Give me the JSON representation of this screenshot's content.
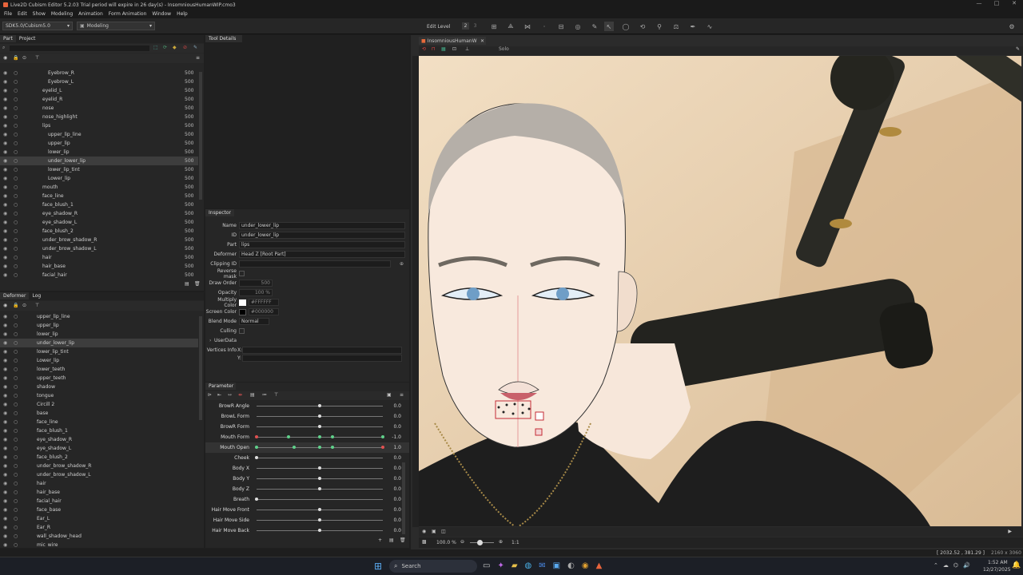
{
  "window": {
    "title": "Live2D Cubism Editor 5.2.03   Trial period will expire in 26 day(s)   - InsomniousHumanWIP.cmo3"
  },
  "menu": [
    "File",
    "Edit",
    "Show",
    "Modeling",
    "Animation",
    "Form Animation",
    "Window",
    "Help"
  ],
  "toolbar": {
    "sdk": "SDK5.0/Cubism5.0",
    "mode": "Modeling",
    "edit_level_label": "Edit Level",
    "edit_level_1": "2",
    "edit_level_2": "3"
  },
  "left_tabs": {
    "part": "Part",
    "project": "Project"
  },
  "parts": [
    {
      "name": "Eyebrow_R",
      "val": "500"
    },
    {
      "name": "Eyebrow_L",
      "val": "500"
    },
    {
      "name": "eyelid_L",
      "val": "500"
    },
    {
      "name": "eyelid_R",
      "val": "500"
    },
    {
      "name": "nose",
      "val": "500"
    },
    {
      "name": "nose_highlight",
      "val": "500"
    },
    {
      "name": "lips",
      "val": "500"
    },
    {
      "name": "upper_lip_line",
      "val": "500"
    },
    {
      "name": "upper_lip",
      "val": "500"
    },
    {
      "name": "lower_lip",
      "val": "500"
    },
    {
      "name": "under_lower_lip",
      "val": "500"
    },
    {
      "name": "lower_lip_tint",
      "val": "500"
    },
    {
      "name": "Lower_lip",
      "val": "500"
    },
    {
      "name": "mouth",
      "val": "500"
    },
    {
      "name": "face_line",
      "val": "500"
    },
    {
      "name": "face_blush_1",
      "val": "500"
    },
    {
      "name": "eye_shadow_R",
      "val": "500"
    },
    {
      "name": "eye_shadow_L",
      "val": "500"
    },
    {
      "name": "face_blush_2",
      "val": "500"
    },
    {
      "name": "under_brow_shadow_R",
      "val": "500"
    },
    {
      "name": "under_brow_shadow_L",
      "val": "500"
    },
    {
      "name": "hair",
      "val": "500"
    },
    {
      "name": "hair_base",
      "val": "500"
    },
    {
      "name": "facial_hair",
      "val": "500"
    }
  ],
  "deformer_tabs": {
    "deformer": "Deformer",
    "log": "Log"
  },
  "deformers": [
    "upper_lip_line",
    "upper_lip",
    "lower_lip",
    "under_lower_lip",
    "lower_lip_tint",
    "Lower_lip",
    "lower_teeth",
    "upper_teeth",
    "shadow",
    "tongue",
    "Circill 2",
    "base",
    "face_line",
    "face_blush_1",
    "eye_shadow_R",
    "eye_shadow_L",
    "face_blush_2",
    "under_brow_shadow_R",
    "under_brow_shadow_L",
    "hair",
    "hair_base",
    "facial_hair",
    "face_base",
    "Ear_L",
    "Ear_R",
    "wall_shadow_head",
    "mic_wire"
  ],
  "tool_details": {
    "title": "Tool Details"
  },
  "inspector": {
    "title": "Inspector",
    "name_label": "Name",
    "name": "under_lower_lip",
    "id_label": "ID",
    "id": "under_lower_lip",
    "part_label": "Part",
    "part": "lips",
    "deformer_label": "Deformer",
    "deformer": "Head Z  [Root Part]",
    "clip_label": "Clipping ID",
    "reverse_label": "Reverse mask",
    "draw_label": "Draw Order",
    "draw": "500",
    "opacity_label": "Opacity",
    "opacity": "100 %",
    "mult_label": "Multiply Color",
    "mult": "#FFFFFF",
    "screen_label": "Screen Color",
    "screen": "#000000",
    "blend_label": "Blend Mode",
    "blend": "Normal",
    "cull_label": "Culling",
    "userdata_label": "UserData",
    "vert_label": "Vertices Info",
    "vx": "X:",
    "vy": "Y:"
  },
  "parameter": {
    "title": "Parameter",
    "rows": [
      {
        "name": "BrowR Angle",
        "val": "0.0",
        "pos": 0.5,
        "dots": []
      },
      {
        "name": "BrowL Form",
        "val": "0.0",
        "pos": 0.5,
        "dots": []
      },
      {
        "name": "BrowR Form",
        "val": "0.0",
        "pos": 0.5,
        "dots": []
      },
      {
        "name": "Mouth Form",
        "val": "-1.0",
        "pos": 0.0,
        "dots": [
          0.25,
          0.5,
          0.6,
          1.0
        ]
      },
      {
        "name": "Mouth Open",
        "val": "1.0",
        "pos": 1.0,
        "dots": [
          0,
          0.3,
          0.5,
          0.6
        ]
      },
      {
        "name": "Cheek",
        "val": "0.0",
        "pos": 0.0,
        "dots": []
      },
      {
        "name": "Body X",
        "val": "0.0",
        "pos": 0.5,
        "dots": []
      },
      {
        "name": "Body Y",
        "val": "0.0",
        "pos": 0.5,
        "dots": []
      },
      {
        "name": "Body Z",
        "val": "0.0",
        "pos": 0.5,
        "dots": []
      },
      {
        "name": "Breath",
        "val": "0.0",
        "pos": 0.0,
        "dots": []
      },
      {
        "name": "Hair Move Front",
        "val": "0.0",
        "pos": 0.5,
        "dots": []
      },
      {
        "name": "Hair Move Side",
        "val": "0.0",
        "pos": 0.5,
        "dots": []
      },
      {
        "name": "Hair Move Back",
        "val": "0.0",
        "pos": 0.5,
        "dots": []
      }
    ]
  },
  "viewport": {
    "tab": "InsomniousHumanW",
    "solo": "Solo",
    "zoom": "100.0 %",
    "ratio": "1:1",
    "coords": "[ 2032.52 , 381.29 ]",
    "size": "2160 x 3060"
  },
  "taskbar": {
    "search": "Search",
    "time": "1:52 AM",
    "date": "12/27/2025"
  }
}
